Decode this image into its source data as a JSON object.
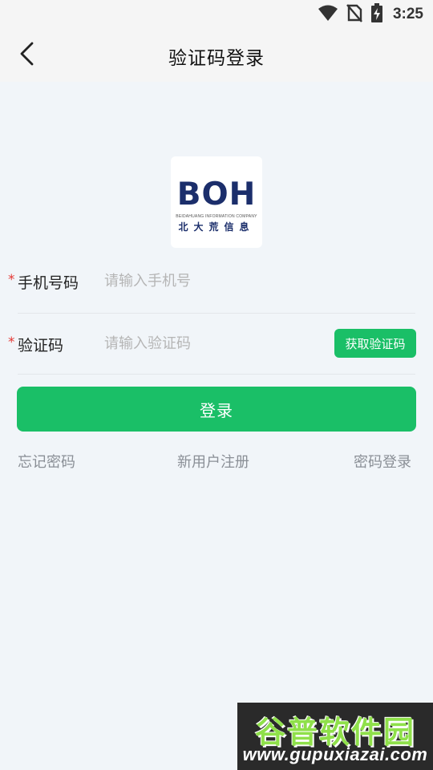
{
  "status_bar": {
    "time": "3:25",
    "icons": [
      "wifi-icon",
      "no-sim-icon",
      "battery-charging-icon"
    ]
  },
  "nav": {
    "title": "验证码登录",
    "back_icon": "chevron-left-icon"
  },
  "logo": {
    "wordmark": "BOH",
    "tagline": "BEIDAHUANG INFORMATION COMPANY",
    "chinese": "北大荒信息"
  },
  "form": {
    "phone": {
      "required_mark": "*",
      "label": "手机号码",
      "placeholder": "请输入手机号",
      "value": ""
    },
    "code": {
      "required_mark": "*",
      "label": "验证码",
      "placeholder": "请输入验证码",
      "value": "",
      "get_code_label": "获取验证码"
    }
  },
  "actions": {
    "login_label": "登录",
    "forgot_password": "忘记密码",
    "register": "新用户注册",
    "password_login": "密码登录"
  },
  "watermark": {
    "cn": "谷普软件园",
    "url": "www.gupuxiazai.com"
  },
  "colors": {
    "accent": "#1abf67",
    "background": "#f1f5f9",
    "required": "#e53935",
    "brand": "#1b2e6b"
  }
}
